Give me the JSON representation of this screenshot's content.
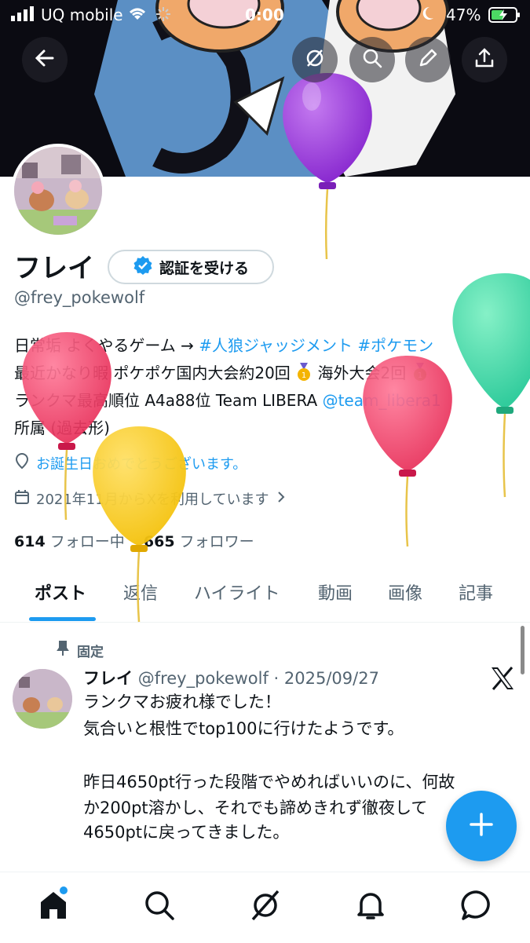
{
  "status_bar": {
    "carrier": "UQ mobile",
    "time": "0:00",
    "battery": "47%"
  },
  "profile": {
    "name": "フレイ",
    "verify_label": "認証を受ける",
    "handle": "@frey_pokewolf",
    "bio_lines": [
      {
        "plain": "日常垢 よくやるゲーム → ",
        "tags": "#人狼ジャッジメント #ポケモン"
      },
      {
        "plain": "最近かなり暇 ポケポケ国内大会約20回",
        "tail": " 海外大会2回"
      },
      {
        "plain": "ランクマ最高順位 A4a88位 Team LIBERA ",
        "mention": "@team_libera1"
      },
      {
        "plain": "所属 (過去形)"
      }
    ],
    "birthday": "お誕生日おめでとうございます。",
    "joined": "2021年11月からXを利用しています",
    "following_count": "614",
    "following_label": "フォロー中",
    "followers_count": "665",
    "followers_label": "フォロワー"
  },
  "tabs": [
    "ポスト",
    "返信",
    "ハイライト",
    "動画",
    "画像",
    "記事"
  ],
  "active_tab": "ポスト",
  "post": {
    "pinned_label": "固定",
    "author": "フレイ",
    "meta": "@frey_pokewolf · 2025/09/27",
    "lines": [
      "ランクマお疲れ様でした！",
      "気合いと根性でtop100に行けたようです。",
      "",
      "昨日4650pt行った段階でやめればいいのに、何故",
      "か200pt溶かし、それでも諦めきれず徹夜して",
      "4650ptに戻ってきました。"
    ]
  },
  "icons": {
    "back": "back-arrow-icon",
    "grok": "grok-icon",
    "search": "search-icon",
    "edit": "pencil-icon",
    "share": "share-icon",
    "location": "location-pin-icon",
    "calendar": "calendar-icon",
    "pin": "pin-icon",
    "x_logo": "x-logo-icon",
    "compose": "plus-icon",
    "nav": [
      "home-icon",
      "search-icon",
      "grok-icon",
      "bell-icon",
      "message-icon"
    ]
  },
  "colors": {
    "accent": "#1d9bf0",
    "text": "#0f1419",
    "muted": "#536471"
  }
}
